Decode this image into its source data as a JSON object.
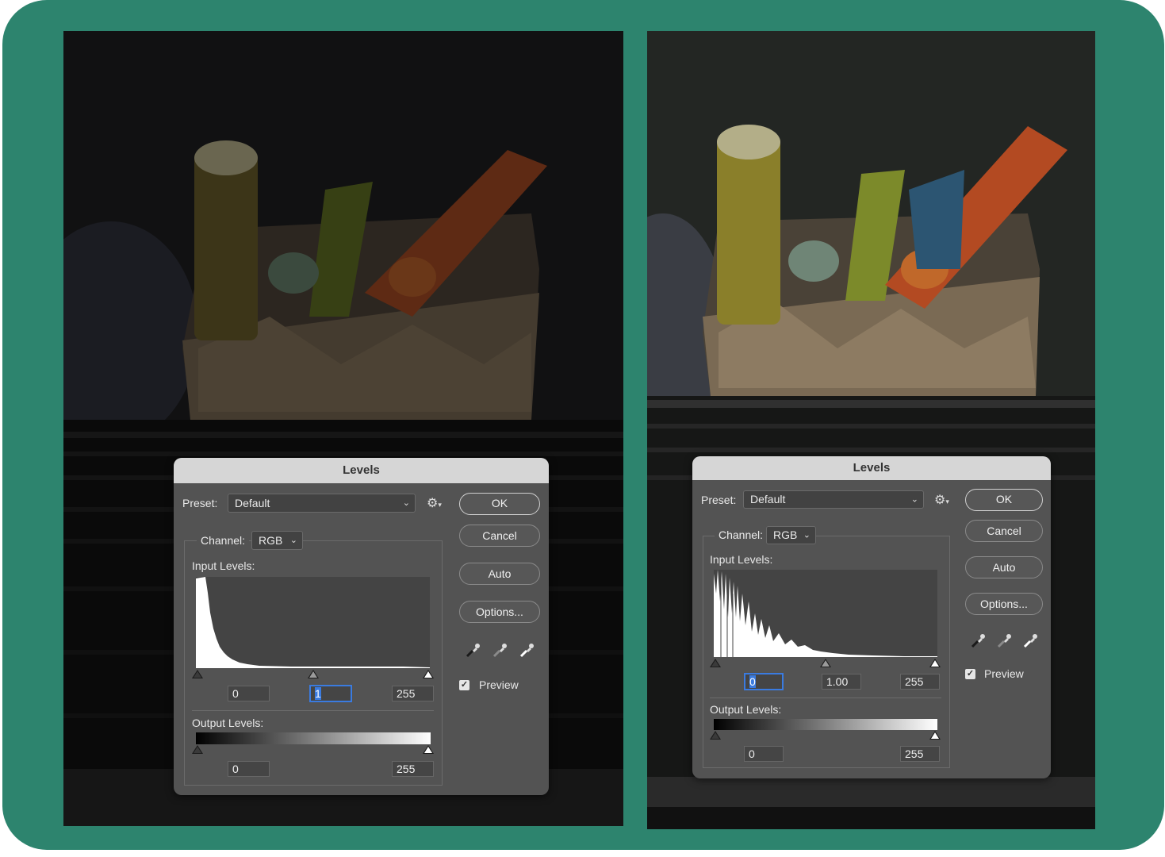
{
  "colors": {
    "frame": "#2d846e",
    "dialog_bg": "#535353",
    "titlebar": "#d6d6d6",
    "highlight": "#3a7be0"
  },
  "before": {
    "dialog": {
      "title": "Levels",
      "preset_label": "Preset:",
      "preset_value": "Default",
      "channel_label": "Channel:",
      "channel_value": "RGB",
      "input_levels_label": "Input Levels:",
      "input_black": "0",
      "input_gamma": "1",
      "input_white": "255",
      "output_levels_label": "Output Levels:",
      "output_black": "0",
      "output_white": "255",
      "buttons": {
        "ok": "OK",
        "cancel": "Cancel",
        "auto": "Auto",
        "options": "Options..."
      },
      "preview_label": "Preview",
      "preview_checked": true,
      "icons": [
        "gear-icon",
        "black-eyedropper-icon",
        "gray-eyedropper-icon",
        "white-eyedropper-icon"
      ]
    }
  },
  "after": {
    "dialog": {
      "title": "Levels",
      "preset_label": "Preset:",
      "preset_value": "Default",
      "channel_label": "Channel:",
      "channel_value": "RGB",
      "input_levels_label": "Input Levels:",
      "input_black": "0",
      "input_gamma": "1.00",
      "input_white": "255",
      "output_levels_label": "Output Levels:",
      "output_black": "0",
      "output_white": "255",
      "buttons": {
        "ok": "OK",
        "cancel": "Cancel",
        "auto": "Auto",
        "options": "Options..."
      },
      "preview_label": "Preview",
      "preview_checked": true,
      "icons": [
        "gear-icon",
        "black-eyedropper-icon",
        "gray-eyedropper-icon",
        "white-eyedropper-icon"
      ]
    }
  }
}
